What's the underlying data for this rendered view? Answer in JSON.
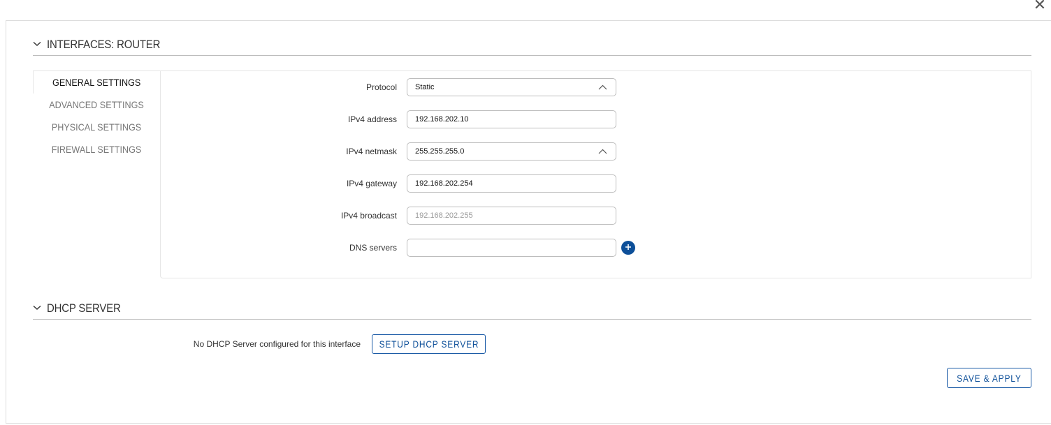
{
  "window": {
    "close_glyph": "✕"
  },
  "interfaces_section": {
    "title": "INTERFACES: ROUTER",
    "tabs": [
      {
        "label": "GENERAL SETTINGS",
        "active": true
      },
      {
        "label": "ADVANCED SETTINGS",
        "active": false
      },
      {
        "label": "PHYSICAL SETTINGS",
        "active": false
      },
      {
        "label": "FIREWALL SETTINGS",
        "active": false
      }
    ],
    "fields": {
      "protocol": {
        "label": "Protocol",
        "value": "Static"
      },
      "ipv4_address": {
        "label": "IPv4 address",
        "value": "192.168.202.10"
      },
      "ipv4_netmask": {
        "label": "IPv4 netmask",
        "value": "255.255.255.0"
      },
      "ipv4_gateway": {
        "label": "IPv4 gateway",
        "value": "192.168.202.254"
      },
      "ipv4_broadcast": {
        "label": "IPv4 broadcast",
        "value": "",
        "placeholder": "192.168.202.255"
      },
      "dns_servers": {
        "label": "DNS servers",
        "value": ""
      }
    }
  },
  "dhcp_section": {
    "title": "DHCP SERVER",
    "message": "No DHCP Server configured for this interface",
    "setup_label": "SETUP DHCP SERVER"
  },
  "footer": {
    "save_label": "SAVE & APPLY"
  },
  "icons": {
    "close": "close-icon",
    "section_toggle": "chevron-down-icon",
    "select_caret": "chevron-up-icon",
    "add": "plus-circle-icon"
  },
  "colors": {
    "accent": "#0d4f99",
    "border": "#bdbdbd"
  }
}
